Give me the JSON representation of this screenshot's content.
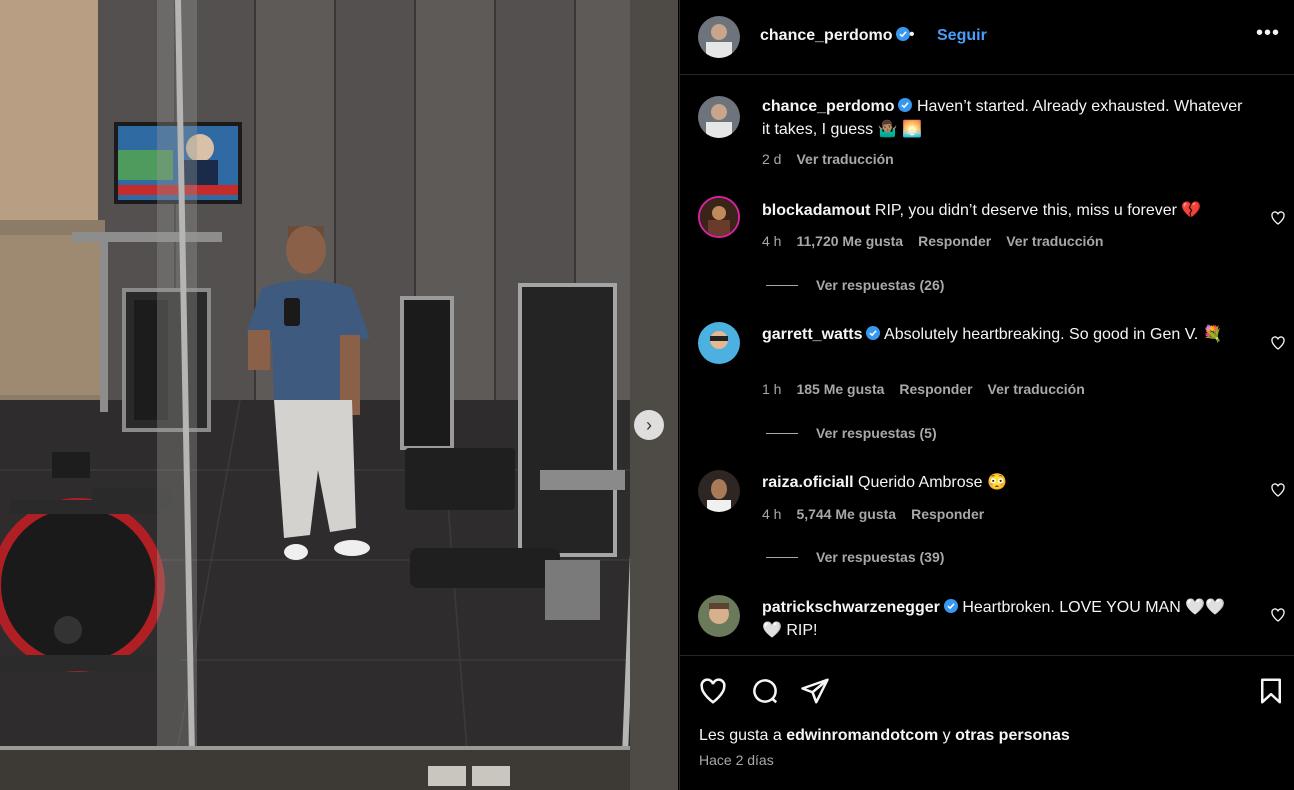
{
  "post": {
    "author": "chance_perdomo",
    "follow_label": "Seguir",
    "separator": "•",
    "more_label": "•••",
    "caption": "Haven’t started. Already exhausted. Whatever it takes, I guess 🤷🏽‍♂️ 🌅",
    "caption_time": "2 d",
    "translate_label": "Ver traducción"
  },
  "comments": [
    {
      "username": "blockadamout",
      "text": "RIP, you didn’t deserve this, miss u forever 💔",
      "time": "4 h",
      "likes": "11,720 Me gusta",
      "reply_label": "Responder",
      "translate_label": "Ver traducción",
      "replies_label": "Ver respuestas (26)"
    },
    {
      "username": "garrett_watts",
      "text": "Absolutely heartbreaking. So good in Gen V. 💐",
      "time": "1 h",
      "likes": "185 Me gusta",
      "reply_label": "Responder",
      "translate_label": "Ver traducción",
      "replies_label": "Ver respuestas (5)"
    },
    {
      "username": "raiza.oficiall",
      "text": "Querido Ambrose 😳",
      "time": "4 h",
      "likes": "5,744 Me gusta",
      "reply_label": "Responder",
      "replies_label": "Ver respuestas (39)"
    },
    {
      "username": "patrickschwarzenegger",
      "text": "Heartbroken. LOVE YOU MAN 🤍🤍 🤍 RIP!"
    }
  ],
  "footer": {
    "likes_prefix": "Les gusta a",
    "likes_user": "edwinromandotcom",
    "likes_middle": "y",
    "likes_suffix": "otras personas",
    "date": "Hace 2 días"
  },
  "colors": {
    "background": "#000000",
    "link_blue": "#4a9df8",
    "verified_blue": "#3897f0",
    "muted_text": "#a8a8a8",
    "story_ring": "#d6249f"
  },
  "icons": [
    "verified-icon",
    "more-options-icon",
    "heart-icon",
    "comment-icon",
    "share-icon",
    "bookmark-icon",
    "next-arrow-icon"
  ]
}
